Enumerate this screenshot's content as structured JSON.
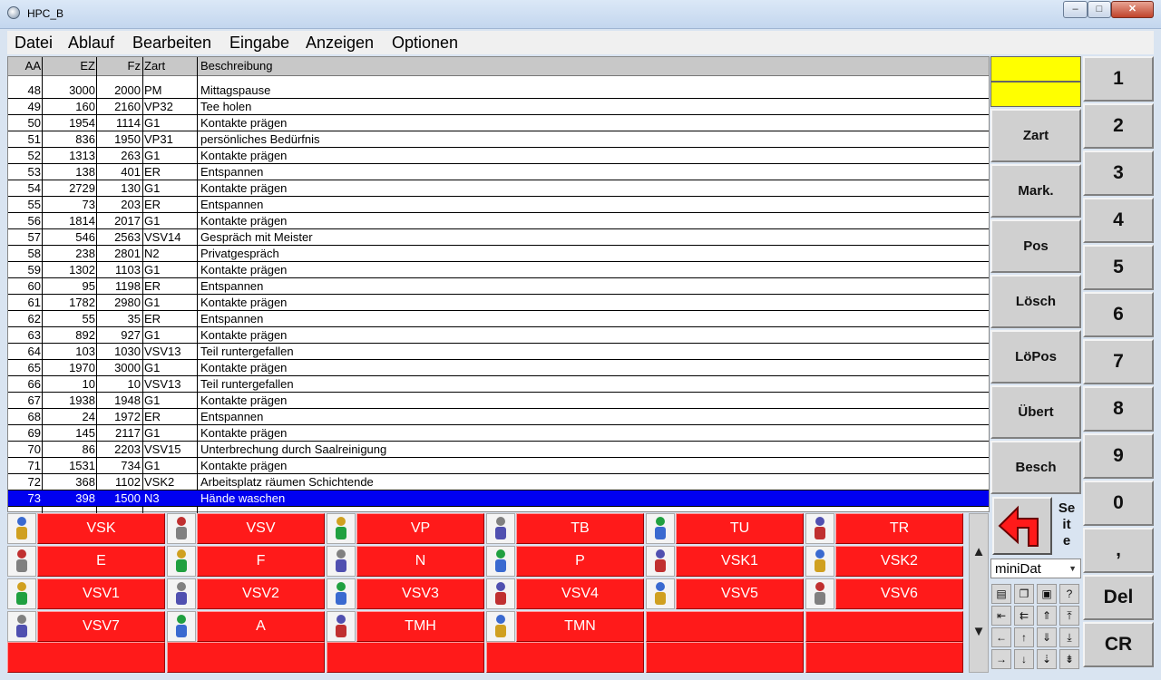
{
  "window": {
    "title": "HPC_B"
  },
  "menu": [
    "Datei",
    "Ablauf",
    "Bearbeiten",
    "Eingabe",
    "Anzeigen",
    "Optionen"
  ],
  "table": {
    "headers": {
      "aa": "AA",
      "ez": "EZ",
      "fz": "Fz",
      "zart": "Zart",
      "desc": "Beschreibung"
    },
    "rows": [
      [
        "48",
        "3000",
        "2000",
        "PM",
        "Mittagspause"
      ],
      [
        "49",
        "160",
        "2160",
        "VP32",
        "Tee holen"
      ],
      [
        "50",
        "1954",
        "1114",
        "G1",
        "Kontakte prägen"
      ],
      [
        "51",
        "836",
        "1950",
        "VP31",
        "persönliches Bedürfnis"
      ],
      [
        "52",
        "1313",
        "263",
        "G1",
        "Kontakte prägen"
      ],
      [
        "53",
        "138",
        "401",
        "ER",
        "Entspannen"
      ],
      [
        "54",
        "2729",
        "130",
        "G1",
        "Kontakte prägen"
      ],
      [
        "55",
        "73",
        "203",
        "ER",
        "Entspannen"
      ],
      [
        "56",
        "1814",
        "2017",
        "G1",
        "Kontakte prägen"
      ],
      [
        "57",
        "546",
        "2563",
        "VSV14",
        "Gespräch mit Meister"
      ],
      [
        "58",
        "238",
        "2801",
        "N2",
        "Privatgespräch"
      ],
      [
        "59",
        "1302",
        "1103",
        "G1",
        "Kontakte prägen"
      ],
      [
        "60",
        "95",
        "1198",
        "ER",
        "Entspannen"
      ],
      [
        "61",
        "1782",
        "2980",
        "G1",
        "Kontakte prägen"
      ],
      [
        "62",
        "55",
        "35",
        "ER",
        "Entspannen"
      ],
      [
        "63",
        "892",
        "927",
        "G1",
        "Kontakte prägen"
      ],
      [
        "64",
        "103",
        "1030",
        "VSV13",
        "Teil runtergefallen"
      ],
      [
        "65",
        "1970",
        "3000",
        "G1",
        "Kontakte prägen"
      ],
      [
        "66",
        "10",
        "10",
        "VSV13",
        "Teil runtergefallen"
      ],
      [
        "67",
        "1938",
        "1948",
        "G1",
        "Kontakte prägen"
      ],
      [
        "68",
        "24",
        "1972",
        "ER",
        "Entspannen"
      ],
      [
        "69",
        "145",
        "2117",
        "G1",
        "Kontakte prägen"
      ],
      [
        "70",
        "86",
        "2203",
        "VSV15",
        "Unterbrechung durch Saalreinigung"
      ],
      [
        "71",
        "1531",
        "734",
        "G1",
        "Kontakte prägen"
      ],
      [
        "72",
        "368",
        "1102",
        "VSK2",
        "Arbeitsplatz räumen Schichtende"
      ],
      [
        "73",
        "398",
        "1500",
        "N3",
        "Hände waschen"
      ]
    ],
    "selected_row": 25
  },
  "side_buttons": [
    "Zart",
    "Mark.",
    "Pos",
    "Lösch",
    "LöPos",
    "Übert",
    "Besch"
  ],
  "numpad": [
    "1",
    "2",
    "3",
    "4",
    "5",
    "6",
    "7",
    "8",
    "9",
    "0",
    ",",
    "Del",
    "CR"
  ],
  "seite": [
    "Se",
    "it",
    "e"
  ],
  "dropdown": {
    "value": "miniDat"
  },
  "categories": [
    [
      "VSK",
      "VSV",
      "VP",
      "TB",
      "TU",
      "TR"
    ],
    [
      "E",
      "F",
      "N",
      "P",
      "VSK1",
      "VSK2"
    ],
    [
      "VSV1",
      "VSV2",
      "VSV3",
      "VSV4",
      "VSV5",
      "VSV6"
    ],
    [
      "VSV7",
      "A",
      "TMH",
      "TMN",
      "",
      ""
    ]
  ],
  "toolbar_icons": [
    "new-doc-icon",
    "copy-icon",
    "save-icon",
    "help-icon"
  ],
  "nav_icons": [
    "first-icon",
    "prev-page-icon",
    "page-up-icon",
    "top-icon",
    "left-icon",
    "up-icon",
    "down-page-icon",
    "bottom-icon"
  ],
  "colors": {
    "selected_row": "#0000f0",
    "category_button": "#ff1a1a",
    "yellow_field": "#ffff00"
  }
}
